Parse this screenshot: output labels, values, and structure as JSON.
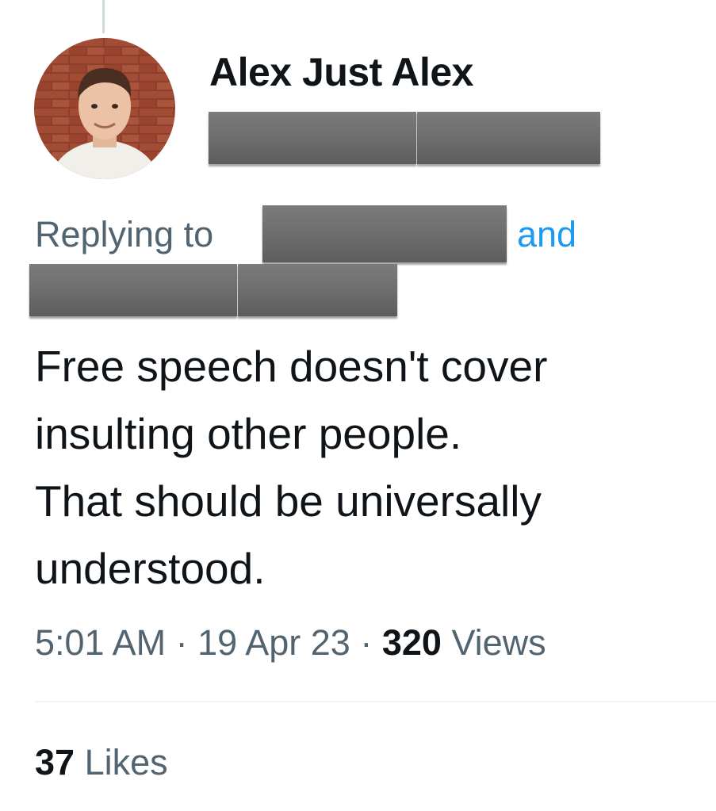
{
  "tweet": {
    "author": {
      "display_name": "Alex Just Alex",
      "avatar": "profile-photo"
    },
    "reply": {
      "label": "Replying to",
      "conjunction": "and"
    },
    "text_lines": [
      "Free speech doesn't cover",
      "insulting other people.",
      "That should be universally",
      "understood."
    ],
    "meta": {
      "time": "5:01 AM",
      "separator": "·",
      "date": "19 Apr 23",
      "views_count": "320",
      "views_label": "Views"
    },
    "stats": {
      "likes_count": "37",
      "likes_label": "Likes"
    }
  },
  "colors": {
    "text_primary": "#0f1419",
    "text_secondary": "#536471",
    "link": "#1d9bf0",
    "redaction": "#707070"
  }
}
